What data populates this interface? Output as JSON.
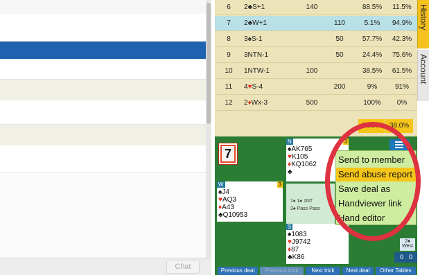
{
  "results_table": {
    "rows": [
      {
        "num": "6",
        "contract_prefix": "2",
        "contract_suit": "♣",
        "contract_suffix": "S+1",
        "suit_red": false,
        "ns": "140",
        "ew": "",
        "pct1": "88.5%",
        "pct2": "11.5%"
      },
      {
        "num": "7",
        "contract_prefix": "2",
        "contract_suit": "♣",
        "contract_suffix": "W+1",
        "suit_red": false,
        "ns": "",
        "ew": "110",
        "pct1": "5.1%",
        "pct2": "94.9%",
        "selected": true
      },
      {
        "num": "8",
        "contract_prefix": "3",
        "contract_suit": "♠",
        "contract_suffix": "S-1",
        "suit_red": false,
        "ns": "",
        "ew": "50",
        "pct1": "57.7%",
        "pct2": "42.3%"
      },
      {
        "num": "9",
        "contract_prefix": "3NTN-1",
        "contract_suit": "",
        "contract_suffix": "",
        "suit_red": false,
        "ns": "",
        "ew": "50",
        "pct1": "24.4%",
        "pct2": "75.6%"
      },
      {
        "num": "10",
        "contract_prefix": "1NTW-1",
        "contract_suit": "",
        "contract_suffix": "",
        "suit_red": false,
        "ns": "100",
        "ew": "",
        "pct1": "38.5%",
        "pct2": "61.5%"
      },
      {
        "num": "11",
        "contract_prefix": "4",
        "contract_suit": "♥",
        "contract_suffix": "S-4",
        "suit_red": true,
        "ns": "",
        "ew": "200",
        "pct1": "9%",
        "pct2": "91%"
      },
      {
        "num": "12",
        "contract_prefix": "2",
        "contract_suit": "♦",
        "contract_suffix": "Wx-3",
        "suit_red": true,
        "ns": "500",
        "ew": "",
        "pct1": "100%",
        "pct2": "0%"
      }
    ],
    "total_pct1": "62.0%",
    "total_pct2": "38.0%"
  },
  "tabs": {
    "history": "History",
    "account": "Account"
  },
  "board": {
    "number": "7",
    "north": {
      "label": "N",
      "count": "3",
      "lines": [
        {
          "suit": "♠",
          "cards": "AK765",
          "red": false
        },
        {
          "suit": "♥",
          "cards": "K105",
          "red": true
        },
        {
          "suit": "♦",
          "cards": "KQ1062",
          "red": true
        },
        {
          "suit": "♣",
          "cards": "",
          "red": false
        }
      ]
    },
    "west": {
      "label": "W",
      "count": "3",
      "lines": [
        {
          "suit": "♠",
          "cards": "J4",
          "red": false
        },
        {
          "suit": "♥",
          "cards": "AQ3",
          "red": true
        },
        {
          "suit": "♦",
          "cards": "A43",
          "red": true
        },
        {
          "suit": "♣",
          "cards": "Q10953",
          "red": false
        }
      ]
    },
    "south": {
      "label": "S",
      "count": "",
      "lines": [
        {
          "suit": "♠",
          "cards": "1083",
          "red": false
        },
        {
          "suit": "♥",
          "cards": "J9742",
          "red": true
        },
        {
          "suit": "♦",
          "cards": "87",
          "red": true
        },
        {
          "suit": "♣",
          "cards": "K86",
          "red": false
        }
      ]
    },
    "bidding": {
      "row1": "1♦   1♠   1NT",
      "row2": "2♠   Pass Pass"
    },
    "trick_badge": {
      "top": "2♠",
      "bottom": "West"
    },
    "score": {
      "left": "0",
      "right": "0"
    }
  },
  "context_menu": {
    "items": [
      {
        "label": "Send to member"
      },
      {
        "label": "Send abuse report",
        "highlighted": true
      },
      {
        "label": "Save deal as"
      },
      {
        "label": "Handviewer link"
      },
      {
        "label": "Hand editor"
      }
    ]
  },
  "nav": {
    "previous_deal": "Previous deal",
    "previous_trick": "Previous trick",
    "next_trick": "Next trick",
    "next_deal": "Next deal",
    "other_tables": "Other Tables"
  },
  "chat": {
    "button_label": "Chat"
  },
  "colors": {
    "felt": "#2a7d33",
    "results_bg": "#ece3b8",
    "selected_row": "#b9e0e6",
    "highlight_yellow": "#f5c518",
    "menu_bg": "#cfeda0",
    "ring_red": "#de3240",
    "selection_blue": "#1f63b0"
  }
}
